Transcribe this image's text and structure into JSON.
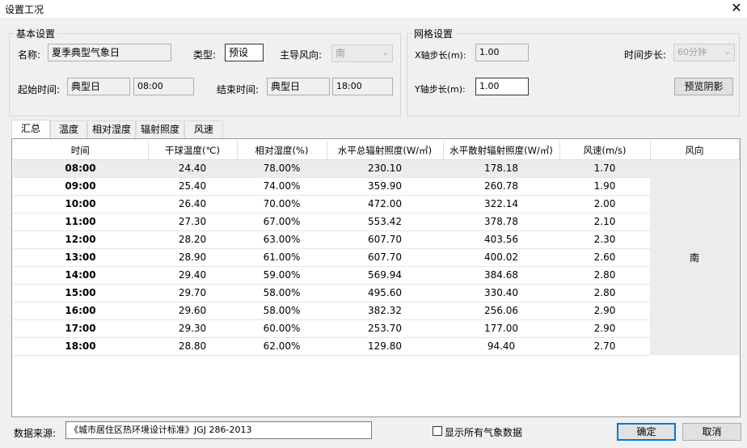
{
  "window": {
    "title": "设置工况",
    "close_glyph": "✕"
  },
  "basic": {
    "group_label": "基本设置",
    "name_label": "名称:",
    "name_value": "夏季典型气象日",
    "type_label": "类型:",
    "type_value": "预设",
    "wind_label": "主导风向:",
    "wind_value": "南",
    "start_label": "起始时间:",
    "start_day": "典型日",
    "start_time": "08:00",
    "end_label": "结束时间:",
    "end_day": "典型日",
    "end_time": "18:00"
  },
  "grid": {
    "group_label": "网格设置",
    "x_label": "X轴步长(m):",
    "x_value": "1.00",
    "y_label": "Y轴步长(m):",
    "y_value": "1.00",
    "step_label": "时间步长:",
    "step_value": "60分钟",
    "preview_label": "预览阴影"
  },
  "tabs": [
    "汇总",
    "温度",
    "相对湿度",
    "辐射照度",
    "风速"
  ],
  "table": {
    "headers": [
      "时间",
      "干球温度(℃)",
      "相对湿度(%)",
      "水平总辐射照度(W/㎡)",
      "水平散射辐射照度(W/㎡)",
      "风速(m/s)",
      "风向"
    ],
    "wind_direction": "南",
    "rows": [
      [
        "08:00",
        "24.40",
        "78.00%",
        "230.10",
        "178.18",
        "1.70"
      ],
      [
        "09:00",
        "25.40",
        "74.00%",
        "359.90",
        "260.78",
        "1.90"
      ],
      [
        "10:00",
        "26.40",
        "70.00%",
        "472.00",
        "322.14",
        "2.00"
      ],
      [
        "11:00",
        "27.30",
        "67.00%",
        "553.42",
        "378.78",
        "2.10"
      ],
      [
        "12:00",
        "28.20",
        "63.00%",
        "607.70",
        "403.56",
        "2.30"
      ],
      [
        "13:00",
        "28.90",
        "61.00%",
        "607.70",
        "400.02",
        "2.60"
      ],
      [
        "14:00",
        "29.40",
        "59.00%",
        "569.94",
        "384.68",
        "2.80"
      ],
      [
        "15:00",
        "29.70",
        "58.00%",
        "495.60",
        "330.40",
        "2.80"
      ],
      [
        "16:00",
        "29.60",
        "58.00%",
        "382.32",
        "256.06",
        "2.90"
      ],
      [
        "17:00",
        "29.30",
        "60.00%",
        "253.70",
        "177.00",
        "2.90"
      ],
      [
        "18:00",
        "28.80",
        "62.00%",
        "129.80",
        "94.40",
        "2.70"
      ]
    ]
  },
  "footer": {
    "source_label": "数据来源:",
    "source_value": "《城市居住区热环境设计标准》JGJ 286-2013",
    "show_all_label": "显示所有气象数据",
    "ok_label": "确定",
    "cancel_label": "取消"
  }
}
